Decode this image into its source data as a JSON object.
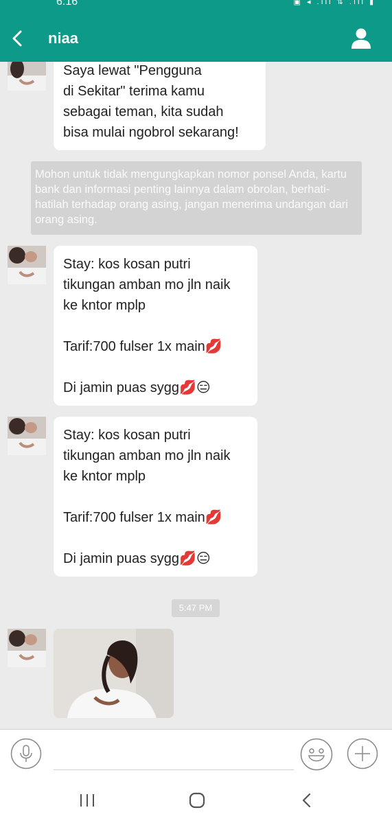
{
  "status_bar": {
    "time": "6:16",
    "icons": "▣ ◂ .ıll ⇅ .ıll ▮"
  },
  "header": {
    "contact_name": "niaa",
    "back_icon": "chevron-left-icon",
    "profile_icon": "person-icon"
  },
  "messages": [
    {
      "text": "Saya lewat \"Pengguna\ndi Sekitar\" terima kamu\nsebagai teman, kita sudah\nbisa mulai ngobrol sekarang!"
    },
    {
      "text": " Stay: kos kosan putri\ntikungan amban mo jln naik\nke kntor mplp\n\nTarif:700 fulser 1x main💋\n\nDi jamin puas sygg💋😑"
    },
    {
      "text": " Stay: kos kosan putri\ntikungan amban mo jln naik\nke kntor mplp\n\nTarif:700 fulser 1x main💋\n\nDi jamin puas sygg💋😑"
    }
  ],
  "system_notice": "Mohon untuk tidak  mengungkapkan nomor ponsel Anda, kartu bank dan informasi penting lainnya dalam obrolan, berhati-hatilah terhadap orang asing, jangan menerima undangan dari orang asing.",
  "timestamp": "5:47 PM",
  "input": {
    "placeholder": "",
    "value": ""
  },
  "colors": {
    "accent": "#0e9a88",
    "chat_bg": "#ebebeb",
    "bubble": "#ffffff",
    "notice_bg": "#d3d3d3"
  },
  "icons": {
    "mic": "microphone-icon",
    "emoji": "smiley-icon",
    "plus": "plus-icon",
    "nav_recent": "recent-apps-icon",
    "nav_home": "home-icon",
    "nav_back": "back-icon"
  }
}
